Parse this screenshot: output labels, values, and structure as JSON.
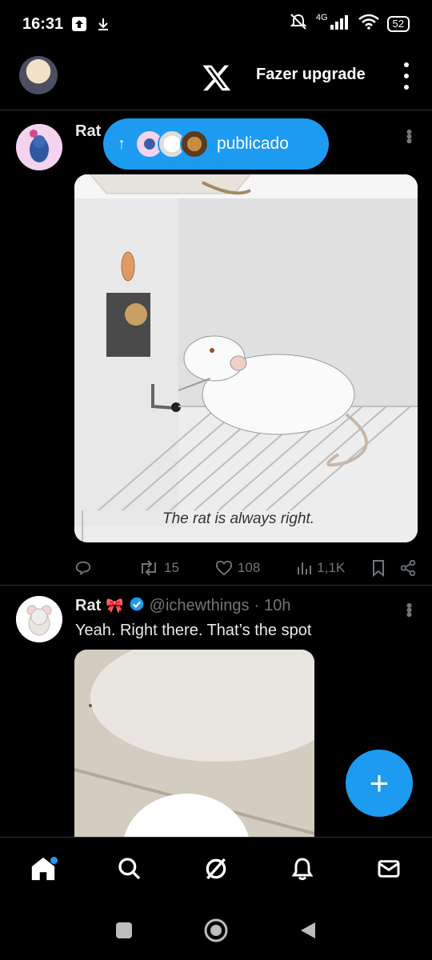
{
  "status_bar": {
    "time": "16:31",
    "network": "4G",
    "battery": "52"
  },
  "header": {
    "upgrade_label": "Fazer upgrade"
  },
  "tweet1": {
    "name_partial": "Rat",
    "actions": {
      "retweets": "15",
      "likes": "108",
      "views": "1,1K"
    },
    "media_caption": "The rat is always right."
  },
  "published_pill": {
    "label": "publicado"
  },
  "tweet2": {
    "name": "Rat",
    "name_emoji": "🎀",
    "handle": "@ichewthings",
    "separator": "·",
    "time": "10h",
    "text": "Yeah. Right there. That’s the spot"
  },
  "fab": {
    "label": "+"
  },
  "colors": {
    "accent": "#1d9bf0",
    "background": "#000000",
    "divider": "#2f3336",
    "muted": "#71767b"
  },
  "icons": {
    "bottom_nav": [
      "home-icon",
      "search-icon",
      "grok-icon",
      "notifications-icon",
      "messages-icon"
    ],
    "system_nav": [
      "recents-icon",
      "home-circle-icon",
      "back-icon"
    ]
  }
}
